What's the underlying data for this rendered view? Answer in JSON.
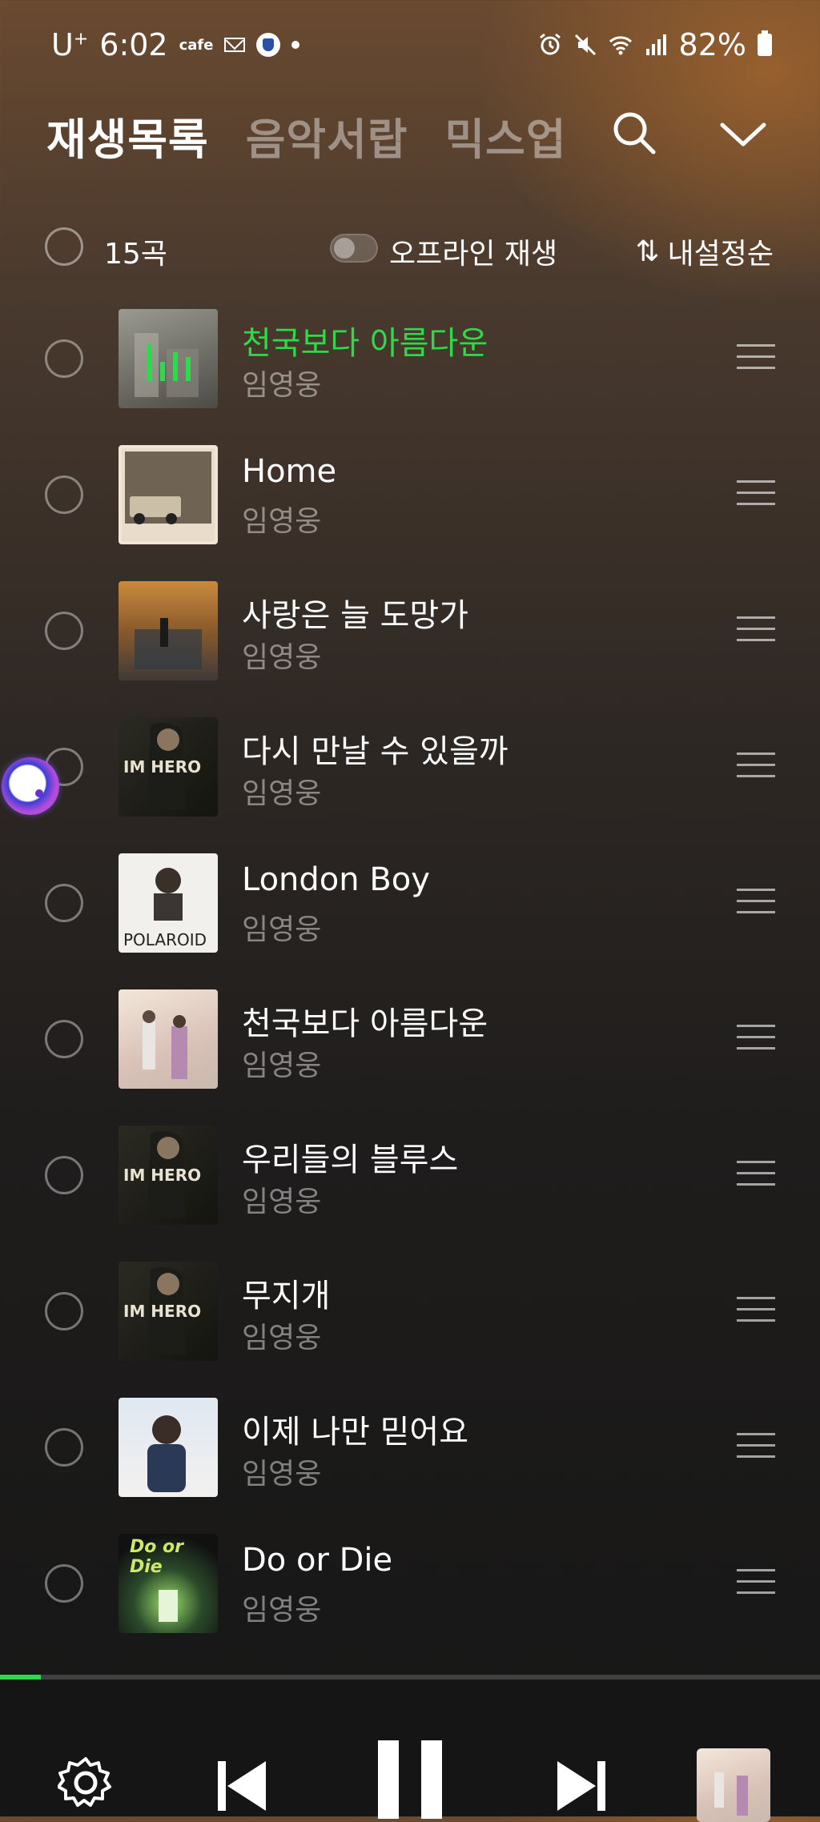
{
  "status_bar": {
    "carrier": "U",
    "carrier_sup": "+",
    "time": "6:02",
    "app_label": "cafe",
    "battery": "82%"
  },
  "header": {
    "tabs": [
      {
        "label": "재생목록",
        "active": true
      },
      {
        "label": "음악서랍",
        "active": false
      },
      {
        "label": "믹스업",
        "active": false
      }
    ],
    "icons": [
      "search-icon",
      "chevron-down-icon"
    ]
  },
  "toolbar": {
    "count": "15곡",
    "offline_label": "오프라인 재생",
    "sort_icon": "⇅",
    "sort_label": "내설정순"
  },
  "songs": [
    {
      "title": "천국보다 아름다운",
      "artist": "임영웅",
      "playing": true
    },
    {
      "title": "Home",
      "artist": "임영웅",
      "playing": false
    },
    {
      "title": "사랑은 늘 도망가",
      "artist": "임영웅",
      "playing": false
    },
    {
      "title": "다시 만날 수 있을까",
      "artist": "임영웅",
      "playing": false
    },
    {
      "title": "London Boy",
      "artist": "임영웅",
      "playing": false
    },
    {
      "title": "천국보다 아름다운",
      "artist": "임영웅",
      "playing": false
    },
    {
      "title": "우리들의 블루스",
      "artist": "임영웅",
      "playing": false
    },
    {
      "title": "무지개",
      "artist": "임영웅",
      "playing": false
    },
    {
      "title": "이제 나만 믿어요",
      "artist": "임영웅",
      "playing": false
    },
    {
      "title": "Do or Die",
      "artist": "임영웅",
      "playing": false
    }
  ],
  "album_art_text": {
    "im_hero": "IM HERO",
    "polaroid": "POLAROID",
    "do_or_die": "Do or Die"
  },
  "playback": {
    "progress": 0.05
  },
  "colors": {
    "accent": "#2fd94a",
    "background_top": "#6a4a30",
    "background_bottom": "#161616"
  }
}
